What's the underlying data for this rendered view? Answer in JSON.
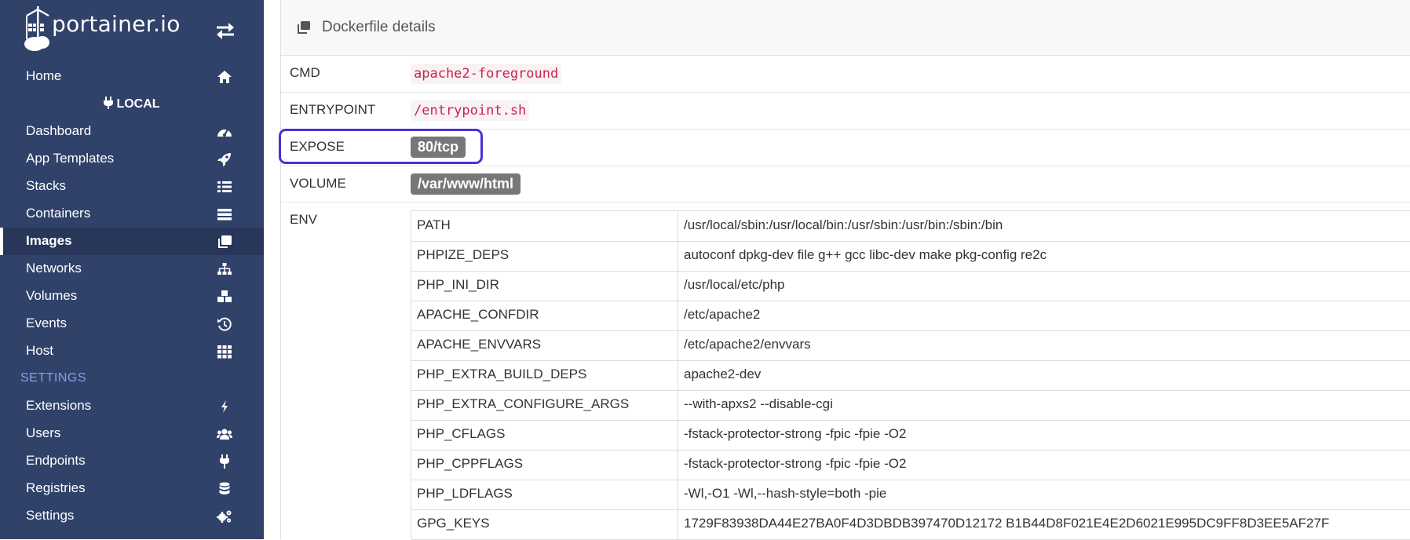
{
  "brand": {
    "name": "portainer.io"
  },
  "sidebar": {
    "home": "Home",
    "endpoint": "LOCAL",
    "items": [
      {
        "label": "Dashboard",
        "icon": "tachometer-icon"
      },
      {
        "label": "App Templates",
        "icon": "rocket-icon"
      },
      {
        "label": "Stacks",
        "icon": "list-icon"
      },
      {
        "label": "Containers",
        "icon": "server-icon"
      },
      {
        "label": "Images",
        "icon": "clone-icon",
        "active": true
      },
      {
        "label": "Networks",
        "icon": "sitemap-icon"
      },
      {
        "label": "Volumes",
        "icon": "cubes-icon"
      },
      {
        "label": "Events",
        "icon": "history-icon"
      },
      {
        "label": "Host",
        "icon": "th-icon"
      }
    ],
    "settings_title": "SETTINGS",
    "settings_items": [
      {
        "label": "Extensions",
        "icon": "bolt-icon"
      },
      {
        "label": "Users",
        "icon": "users-icon"
      },
      {
        "label": "Endpoints",
        "icon": "plug-icon"
      },
      {
        "label": "Registries",
        "icon": "database-icon"
      },
      {
        "label": "Settings",
        "icon": "cogs-icon"
      }
    ]
  },
  "panel": {
    "title": "Dockerfile details",
    "cmd": {
      "key": "CMD",
      "value": "apache2-foreground"
    },
    "entrypoint": {
      "key": "ENTRYPOINT",
      "value": "/entrypoint.sh"
    },
    "expose": {
      "key": "EXPOSE",
      "value": "80/tcp"
    },
    "volume": {
      "key": "VOLUME",
      "value": "/var/www/html"
    },
    "env": {
      "key": "ENV",
      "rows": [
        [
          "PATH",
          "/usr/local/sbin:/usr/local/bin:/usr/sbin:/usr/bin:/sbin:/bin"
        ],
        [
          "PHPIZE_DEPS",
          "autoconf dpkg-dev file g++ gcc libc-dev make pkg-config re2c"
        ],
        [
          "PHP_INI_DIR",
          "/usr/local/etc/php"
        ],
        [
          "APACHE_CONFDIR",
          "/etc/apache2"
        ],
        [
          "APACHE_ENVVARS",
          "/etc/apache2/envvars"
        ],
        [
          "PHP_EXTRA_BUILD_DEPS",
          "apache2-dev"
        ],
        [
          "PHP_EXTRA_CONFIGURE_ARGS",
          "--with-apxs2 --disable-cgi"
        ],
        [
          "PHP_CFLAGS",
          "-fstack-protector-strong -fpic -fpie -O2"
        ],
        [
          "PHP_CPPFLAGS",
          "-fstack-protector-strong -fpic -fpie -O2"
        ],
        [
          "PHP_LDFLAGS",
          "-Wl,-O1 -Wl,--hash-style=both -pie"
        ],
        [
          "GPG_KEYS",
          "1729F83938DA44E27BA0F4D3DBDB397470D12172 B1B44D8F021E4E2D6021E995DC9FF8D3EE5AF27F"
        ]
      ]
    }
  },
  "colors": {
    "sidebar_bg": "#30426a",
    "sidebar_active_bg": "#273659",
    "settings_title": "#7fa2e2",
    "code_text": "#c7254e",
    "code_bg": "#f9f2f4",
    "label_bg": "#777777",
    "highlight_border": "#4f2fd6"
  }
}
